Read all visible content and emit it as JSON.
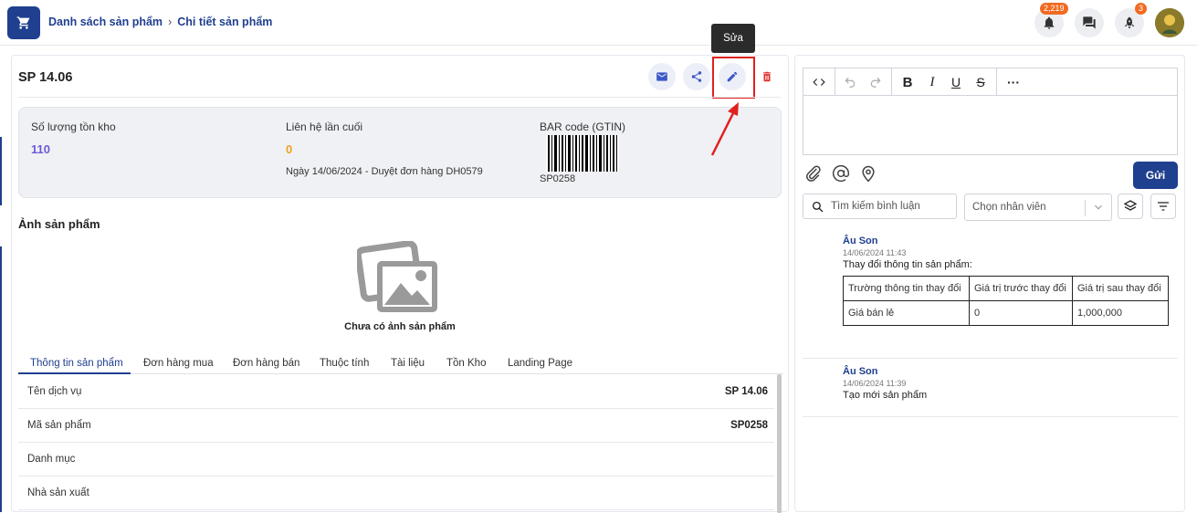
{
  "header": {
    "breadcrumb_1": "Danh sách sản phẩm",
    "breadcrumb_2": "Chi tiết sản phẩm",
    "notifications_count": "2,219",
    "rocket_count": "3"
  },
  "product": {
    "title": "SP 14.06",
    "tooltip": "Sửa"
  },
  "stats": {
    "stock_label": "Số lượng tồn kho",
    "stock_value": "110",
    "contact_label": "Liên hệ lần cuối",
    "contact_value": "0",
    "contact_sub": "Ngày 14/06/2024 - Duyệt đơn hàng DH0579",
    "barcode_label": "BAR code (GTIN)",
    "barcode_value": "SP0258"
  },
  "images": {
    "section_title": "Ảnh sản phẩm",
    "empty_text": "Chưa có ảnh sản phẩm"
  },
  "tabs": [
    "Thông tin sản phẩm",
    "Đơn hàng mua",
    "Đơn hàng bán",
    "Thuộc tính",
    "Tài liệu",
    "Tồn Kho",
    "Landing Page"
  ],
  "info_rows": [
    {
      "key": "Tên dịch vụ",
      "value": "SP 14.06"
    },
    {
      "key": "Mã sản phẩm",
      "value": "SP0258"
    },
    {
      "key": "Danh mục",
      "value": ""
    },
    {
      "key": "Nhà sản xuất",
      "value": ""
    }
  ],
  "comments_panel": {
    "send_label": "Gửi",
    "search_placeholder": "Tìm kiếm bình luận",
    "staff_placeholder": "Chọn nhân viên",
    "comments": [
      {
        "author": "Âu Son",
        "time": "14/06/2024 11:43",
        "text": "Thay đổi thông tin sản phẩm:",
        "table": {
          "headers": [
            "Trường thông tin thay đổi",
            "Giá trị trước thay đổi",
            "Giá trị sau thay đổi"
          ],
          "rows": [
            [
              "Giá bán lẻ",
              "0",
              "1,000,000"
            ]
          ]
        }
      },
      {
        "author": "Âu Son",
        "time": "14/06/2024 11:39",
        "text": "Tạo mới sản phẩm"
      }
    ]
  },
  "colors": {
    "primary": "#1f3f8f",
    "stock_value": "#6a5ad6",
    "contact_value": "#f0a020",
    "delete": "#e03030",
    "highlight": "#e02020"
  }
}
